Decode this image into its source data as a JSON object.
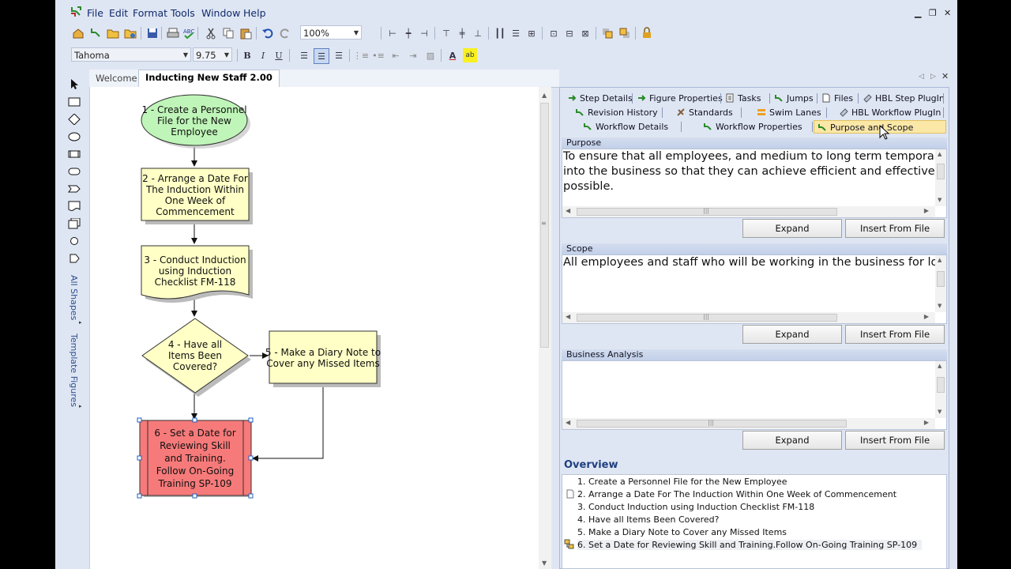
{
  "menu": [
    "File",
    "Edit",
    "Format",
    "Tools",
    "Window",
    "Help"
  ],
  "toolbar": {
    "zoom": "100%",
    "font": "Tahoma",
    "font_size": "9.75"
  },
  "sidebar": {
    "tab1": "All Shapes",
    "tab2": "Template Figures"
  },
  "doc_tabs": {
    "welcome": "Welcome",
    "active": "Inducting New Staff 2.00"
  },
  "flow": {
    "n1": [
      "1 - Create a Personnel",
      "File for the New",
      "Employee"
    ],
    "n2": [
      "2 - Arrange a Date For",
      "The Induction Within",
      "One Week of",
      "Commencement"
    ],
    "n3": [
      "3 - Conduct Induction",
      "using Induction",
      "Checklist FM-118"
    ],
    "n4": [
      "4 - Have all",
      "Items Been",
      "Covered?"
    ],
    "n5": [
      "5 - Make a Diary Note to",
      "Cover any Missed Items"
    ],
    "n6": [
      "6 - Set a Date for",
      "Reviewing Skill",
      "and Training.",
      "Follow On-Going",
      "Training SP-109"
    ]
  },
  "panel_tabs": {
    "row1": [
      "Step Details",
      "Figure Properties",
      "Tasks",
      "Jumps",
      "Files",
      "HBL Step PlugIn"
    ],
    "row2": [
      "Revision History",
      "Standards",
      "Swim Lanes",
      "HBL Workflow PlugIn"
    ],
    "row3": [
      "Workflow Details",
      "Workflow Properties",
      "Purpose and Scope"
    ]
  },
  "purpose": {
    "label": "Purpose",
    "line1": "To ensure that all employees, and medium to long term temporary s",
    "line2": "into the business so that they can achieve efficient and effective ou",
    "line3": "possible."
  },
  "scope": {
    "label": "Scope",
    "line1": "All employees and staff who will be working in the business for long"
  },
  "business": {
    "label": "Business Analysis"
  },
  "buttons": {
    "expand": "Expand",
    "insert": "Insert From File"
  },
  "overview": {
    "title": "Overview",
    "items": [
      "1. Create a Personnel File for the New Employee",
      "2. Arrange a Date For The Induction Within One Week of Commencement",
      "3. Conduct Induction using Induction Checklist FM-118",
      "4. Have all Items Been Covered?",
      "5. Make a Diary Note to Cover any Missed Items",
      "6. Set a Date for Reviewing Skill and Training.Follow On-Going Training SP-109"
    ]
  },
  "colors": {
    "start": "#bff5b8",
    "process": "#ffffc6",
    "selected": "#f77a7a",
    "accent": "#2f4f8f",
    "active_tab": "#fbe8a6"
  }
}
